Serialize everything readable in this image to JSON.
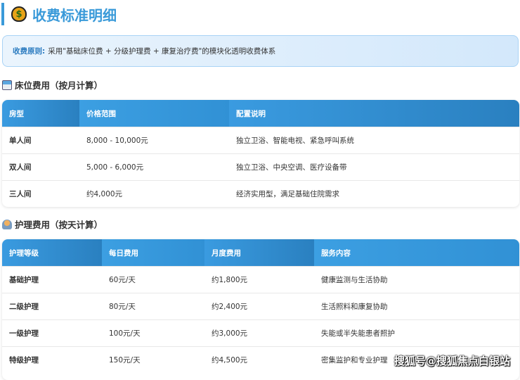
{
  "title": "收费标准明细",
  "title_icon": "money-bag-icon",
  "principle": {
    "label": "收费原则:",
    "text": "采用\"基础床位费 + 分级护理费 + 康复治疗费\"的模块化透明收费体系"
  },
  "bed": {
    "heading": "床位费用（按月计算）",
    "icon": "hospital-icon",
    "headers": [
      "房型",
      "价格范围",
      "配置说明"
    ],
    "rows": [
      [
        "单人间",
        "8,000 - 10,000元",
        "独立卫浴、智能电视、紧急呼叫系统"
      ],
      [
        "双人间",
        "5,000 - 6,000元",
        "独立卫浴、中央空调、医疗设备带"
      ],
      [
        "三人间",
        "约4,000元",
        "经济实用型，满足基础住院需求"
      ]
    ]
  },
  "care": {
    "heading": "护理费用（按天计算）",
    "icon": "nurse-icon",
    "headers": [
      "护理等级",
      "每日费用",
      "月度费用",
      "服务内容"
    ],
    "rows": [
      [
        "基础护理",
        "60元/天",
        "约1,800元",
        "健康监测与生活协助"
      ],
      [
        "二级护理",
        "80元/天",
        "约2,400元",
        "生活照料和康复协助"
      ],
      [
        "一级护理",
        "100元/天",
        "约3,000元",
        "失能或半失能患者照护"
      ],
      [
        "特级护理",
        "150元/天",
        "约4,500元",
        "密集监护和专业护理"
      ]
    ]
  },
  "watermark": "搜狐号@搜狐焦点白银站"
}
